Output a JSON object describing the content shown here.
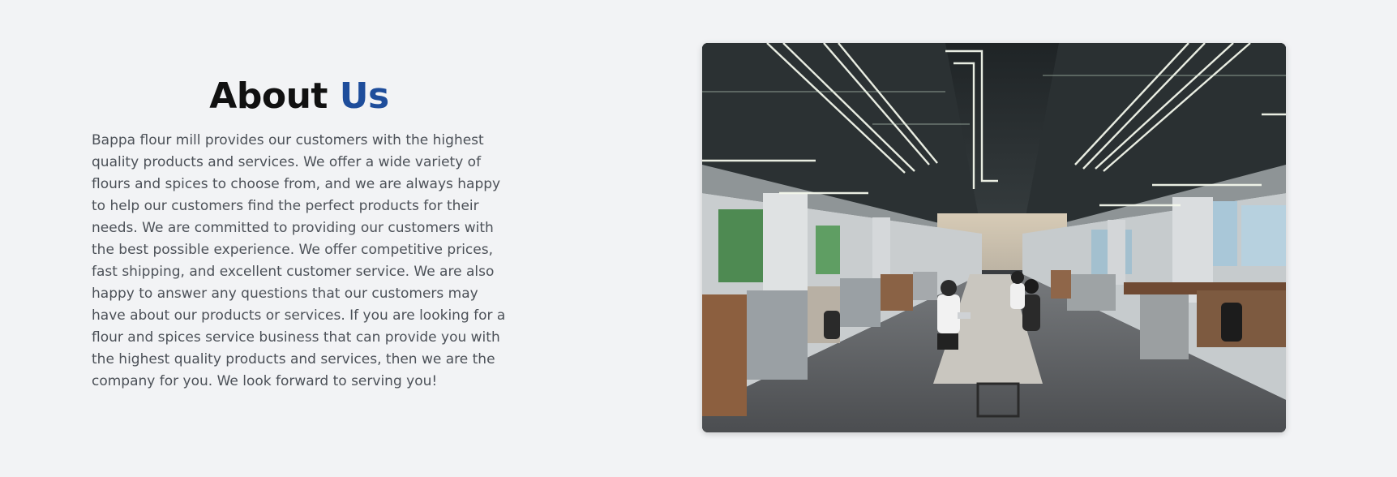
{
  "about": {
    "heading_main": "About",
    "heading_accent": "Us",
    "body": "Bappa flour mill provides our customers with the highest quality products and services. We offer a wide variety of flours and spices to choose from, and we are always happy to help our customers find the perfect products for their needs. We are committed to providing our customers with the best possible experience. We offer competitive prices, fast shipping, and excellent customer service. We are also happy to answer any questions that our customers may have about our products or services. If you are looking for a flour and spices service business that can provide you with the highest quality products and services, then we are the company for you. We look forward to serving you!"
  },
  "colors": {
    "background": "#f2f3f5",
    "heading": "#111111",
    "accent": "#1e4d9b",
    "body_text": "#4c5158"
  },
  "image": {
    "subject": "open-plan-office-photo"
  }
}
